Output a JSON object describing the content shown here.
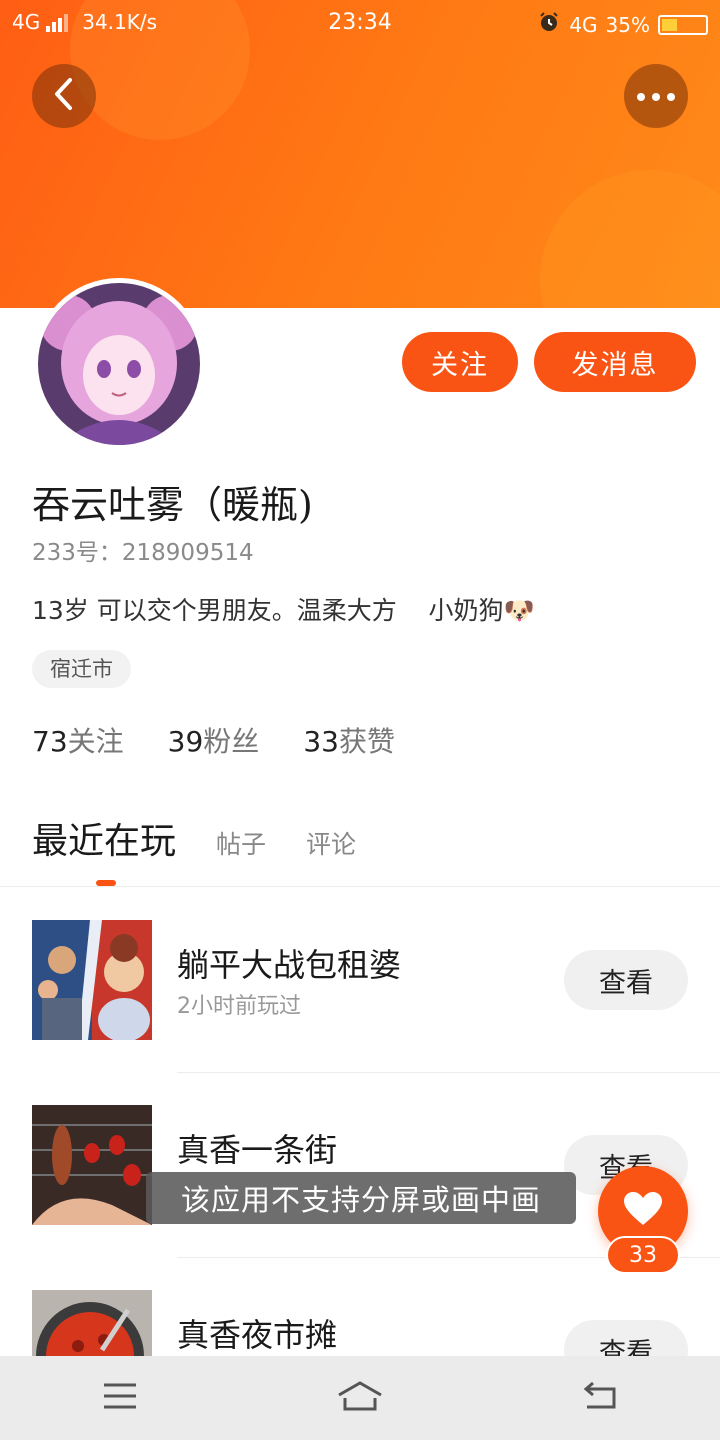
{
  "status_bar": {
    "network_left": "4G",
    "speed": "34.1K/s",
    "time": "23:34",
    "network_right": "4G",
    "battery": "35%",
    "battery_level": 0.35
  },
  "colors": {
    "accent": "#fa5414",
    "header_gradient_start": "#ff5e14",
    "header_gradient_end": "#ff8a1a"
  },
  "profile": {
    "name": "吞云吐雾（暖瓶)",
    "uid": "233号：218909514",
    "bio": "13岁 可以交个男朋友。温柔大方    小奶狗",
    "bio_emoji": "🐶",
    "city": "宿迁市",
    "follow_label": "关注",
    "message_label": "发消息",
    "stats": [
      {
        "num": "73",
        "label": "关注"
      },
      {
        "num": "39",
        "label": "粉丝"
      },
      {
        "num": "33",
        "label": "获赞"
      }
    ]
  },
  "tabs": {
    "active": "最近在玩",
    "posts": "帖子",
    "comments": "评论"
  },
  "games": [
    {
      "title": "躺平大战包租婆",
      "subtitle": "2小时前玩过",
      "button": "查看"
    },
    {
      "title": "真香一条街",
      "subtitle": "",
      "button": "查看"
    },
    {
      "title": "真香夜市摊",
      "subtitle": "",
      "button": "查看"
    }
  ],
  "toast": "该应用不支持分屏或画中画",
  "like_count": "33",
  "icons": {
    "back": "chevron-left-icon",
    "more": "more-dots-icon",
    "like": "heart-icon",
    "nav_menu": "menu-icon",
    "nav_home": "home-icon",
    "nav_back": "back-icon"
  }
}
